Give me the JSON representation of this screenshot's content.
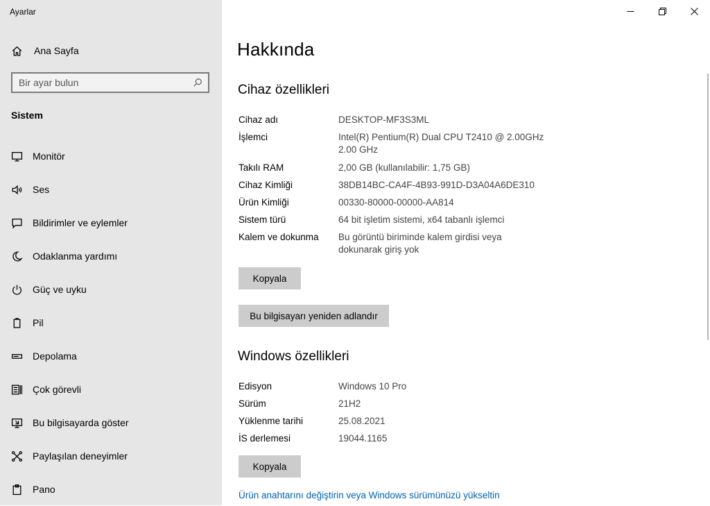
{
  "window": {
    "app_title": "Ayarlar",
    "controls": [
      "minimize-icon",
      "restore-icon",
      "close-icon"
    ]
  },
  "sidebar": {
    "home": {
      "label": "Ana Sayfa",
      "icon": "home-icon"
    },
    "search": {
      "placeholder": "Bir ayar bulun",
      "value": "",
      "icon": "search-icon"
    },
    "section_label": "Sistem",
    "items": [
      {
        "label": "Monitör",
        "icon": "monitor-icon"
      },
      {
        "label": "Ses",
        "icon": "speaker-icon"
      },
      {
        "label": "Bildirimler ve eylemler",
        "icon": "notification-icon"
      },
      {
        "label": "Odaklanma yardımı",
        "icon": "moon-icon"
      },
      {
        "label": "Güç ve uyku",
        "icon": "power-icon"
      },
      {
        "label": "Pil",
        "icon": "battery-icon"
      },
      {
        "label": "Depolama",
        "icon": "storage-icon"
      },
      {
        "label": "Çok görevli",
        "icon": "multitasking-icon"
      },
      {
        "label": "Bu bilgisayarda göster",
        "icon": "projecting-icon"
      },
      {
        "label": "Paylaşılan deneyimler",
        "icon": "shared-experiences-icon"
      },
      {
        "label": "Pano",
        "icon": "clipboard-icon"
      }
    ]
  },
  "main": {
    "title": "Hakkında",
    "device": {
      "heading": "Cihaz özellikleri",
      "rows": [
        {
          "key": "Cihaz adı",
          "value": "DESKTOP-MF3S3ML"
        },
        {
          "key": "İşlemci",
          "value": "Intel(R) Pentium(R) Dual  CPU  T2410  @ 2.00GHz   2.00 GHz"
        },
        {
          "key": "Takılı RAM",
          "value": "2,00 GB (kullanılabilir: 1,75 GB)"
        },
        {
          "key": "Cihaz Kimliği",
          "value": "38DB14BC-CA4F-4B93-991D-D3A04A6DE310"
        },
        {
          "key": "Ürün Kimliği",
          "value": "00330-80000-00000-AA814"
        },
        {
          "key": "Sistem türü",
          "value": "64 bit işletim sistemi, x64 tabanlı işlemci"
        },
        {
          "key": "Kalem ve dokunma",
          "value": "Bu görüntü biriminde kalem girdisi veya dokunarak giriş yok"
        }
      ],
      "copy_button": "Kopyala",
      "rename_button": "Bu bilgisayarı yeniden adlandır"
    },
    "windows": {
      "heading": "Windows özellikleri",
      "rows": [
        {
          "key": "Edisyon",
          "value": "Windows 10 Pro"
        },
        {
          "key": "Sürüm",
          "value": "21H2"
        },
        {
          "key": "Yüklenme tarihi",
          "value": "25.08.2021"
        },
        {
          "key": "İS derlemesi",
          "value": "19044.1165"
        }
      ],
      "copy_button": "Kopyala"
    },
    "upgrade_link": "Ürün anahtarını değiştirin veya Windows sürümünüzü yükseltin"
  }
}
